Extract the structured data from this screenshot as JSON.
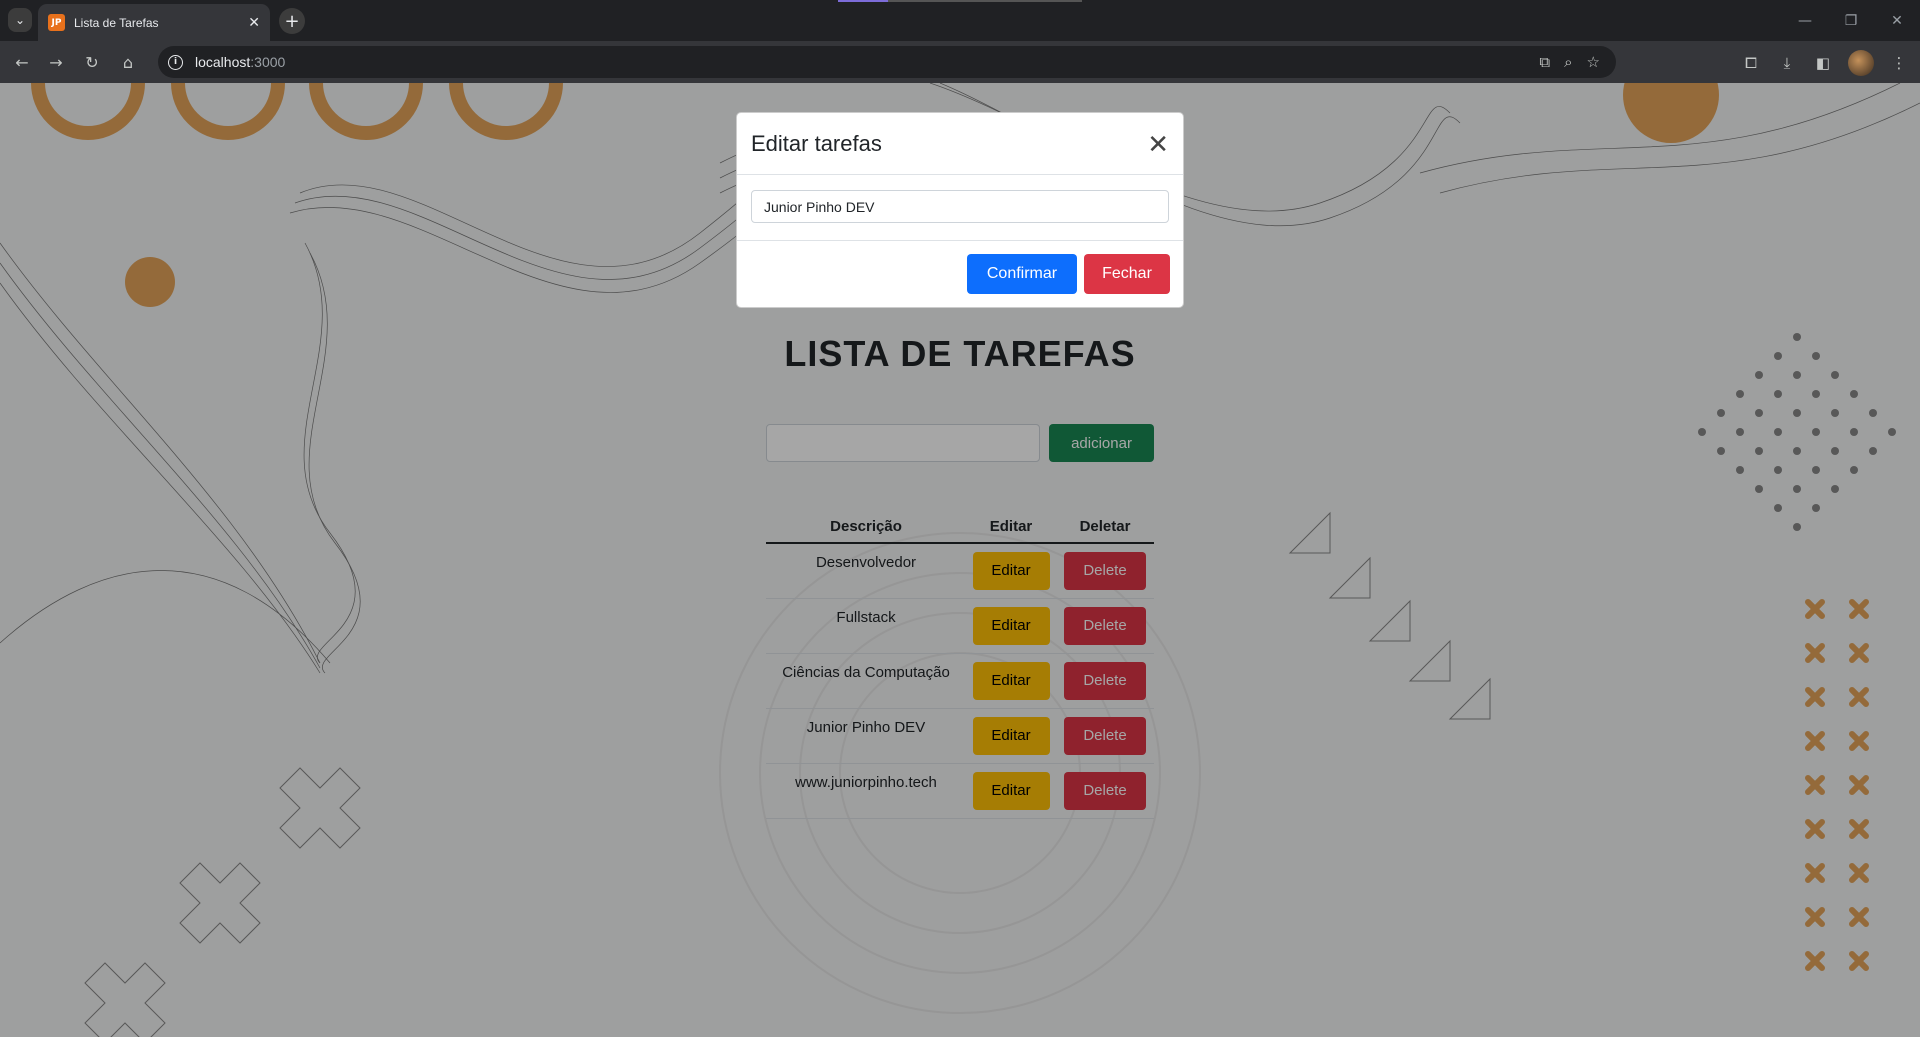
{
  "browser": {
    "tab_title": "Lista de Tarefas",
    "favicon_text": "JP",
    "url_host": "localhost",
    "url_port": ":3000"
  },
  "app": {
    "title": "LISTA DE TAREFAS",
    "new_task_value": "",
    "add_label": "adicionar",
    "columns": [
      "Descrição",
      "Editar",
      "Deletar"
    ],
    "edit_label": "Editar",
    "delete_label": "Delete",
    "tasks": [
      {
        "description": "Desenvolvedor"
      },
      {
        "description": "Fullstack"
      },
      {
        "description": "Ciências da Computação"
      },
      {
        "description": "Junior Pinho DEV"
      },
      {
        "description": "www.juniorpinho.tech"
      }
    ]
  },
  "modal": {
    "title": "Editar tarefas",
    "close_symbol": "✕",
    "input_value": "Junior Pinho DEV",
    "confirm_label": "Confirmar",
    "close_label": "Fechar"
  },
  "colors": {
    "primary": "#0d6efd",
    "success": "#198754",
    "warning": "#ffc107",
    "danger": "#dc3545",
    "accent_orange": "#e8a35b"
  }
}
